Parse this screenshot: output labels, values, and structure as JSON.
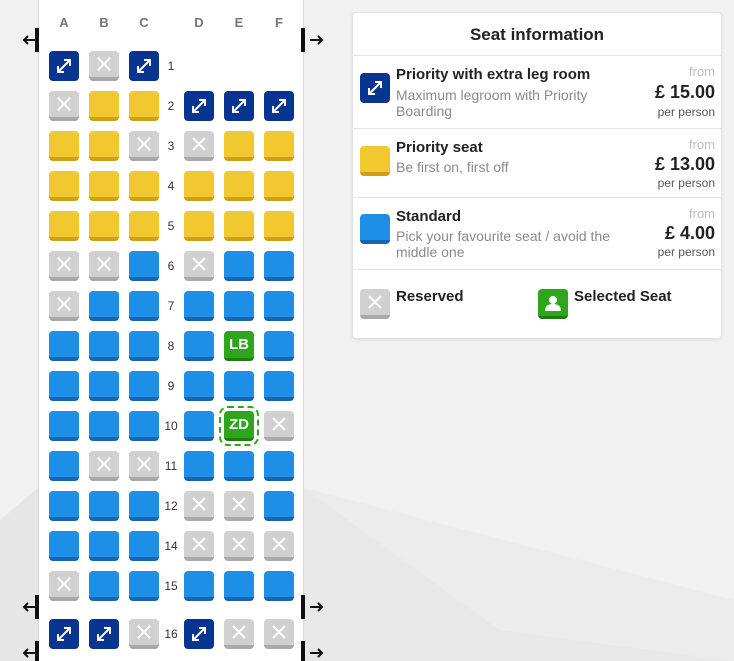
{
  "columns_left": [
    "A",
    "B",
    "C"
  ],
  "columns_right": [
    "D",
    "E",
    "F"
  ],
  "rows": [
    {
      "num": "1",
      "seats": [
        "legroom",
        "reserved",
        "legroom",
        null,
        null,
        null
      ]
    },
    {
      "num": "2",
      "seats": [
        "reserved",
        "priority",
        "priority",
        "legroom",
        "legroom",
        "legroom"
      ]
    },
    {
      "num": "3",
      "seats": [
        "priority",
        "priority",
        "reserved",
        "reserved",
        "priority",
        "priority"
      ]
    },
    {
      "num": "4",
      "seats": [
        "priority",
        "priority",
        "priority",
        "priority",
        "priority",
        "priority"
      ]
    },
    {
      "num": "5",
      "seats": [
        "priority",
        "priority",
        "priority",
        "priority",
        "priority",
        "priority"
      ]
    },
    {
      "num": "6",
      "seats": [
        "reserved",
        "reserved",
        "standard",
        "reserved",
        "standard",
        "standard"
      ]
    },
    {
      "num": "7",
      "seats": [
        "reserved",
        "standard",
        "standard",
        "standard",
        "standard",
        "standard"
      ]
    },
    {
      "num": "8",
      "seats": [
        "standard",
        "standard",
        "standard",
        "standard",
        "selected:LB",
        "standard"
      ]
    },
    {
      "num": "9",
      "seats": [
        "standard",
        "standard",
        "standard",
        "standard",
        "standard",
        "standard"
      ]
    },
    {
      "num": "10",
      "seats": [
        "standard",
        "standard",
        "standard",
        "standard",
        "selected:ZD",
        "reserved"
      ]
    },
    {
      "num": "11",
      "seats": [
        "standard",
        "reserved",
        "reserved",
        "standard",
        "standard",
        "standard"
      ]
    },
    {
      "num": "12",
      "seats": [
        "standard",
        "standard",
        "standard",
        "reserved",
        "reserved",
        "standard"
      ]
    },
    {
      "num": "14",
      "seats": [
        "standard",
        "standard",
        "standard",
        "reserved",
        "reserved",
        "reserved"
      ]
    },
    {
      "num": "15",
      "seats": [
        "reserved",
        "standard",
        "standard",
        "standard",
        "standard",
        "standard"
      ]
    },
    {
      "num": "16",
      "seats": [
        "legroom",
        "legroom",
        "reserved",
        "legroom",
        "reserved",
        "reserved"
      ]
    }
  ],
  "focused_seat": "10E",
  "info": {
    "title": "Seat information",
    "legroom": {
      "name": "Priority with extra leg room",
      "desc": "Maximum legroom with Priority Boarding",
      "from": "from",
      "price": "£ 15.00",
      "per": "per person"
    },
    "priority": {
      "name": "Priority seat",
      "desc": "Be first on, first off",
      "from": "from",
      "price": "£ 13.00",
      "per": "per person"
    },
    "standard": {
      "name": "Standard",
      "desc": "Pick your favourite seat / avoid the middle one",
      "from": "from",
      "price": "£ 4.00",
      "per": "per person"
    },
    "reserved_label": "Reserved",
    "selected_label": "Selected Seat"
  },
  "colors": {
    "standard": "#1e8fe6",
    "priority": "#f2c830",
    "legroom": "#073590",
    "reserved": "#d0d0d0",
    "selected": "#2fa51e"
  }
}
